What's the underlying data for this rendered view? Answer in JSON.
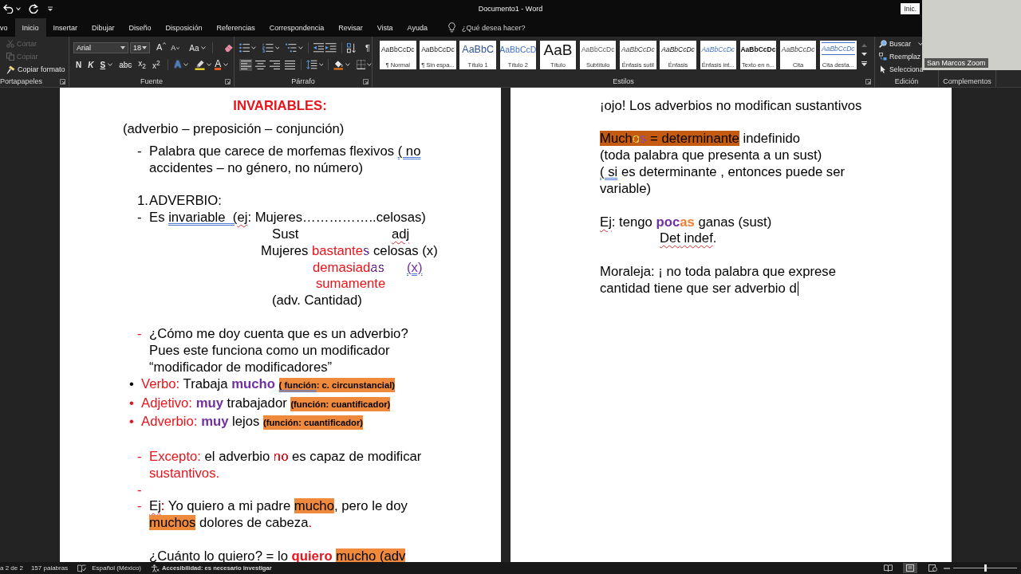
{
  "window": {
    "title": "Documento1 - Word",
    "account_button": "Inic."
  },
  "ribbon_tabs": [
    {
      "label": "vo",
      "selected": false
    },
    {
      "label": "Inicio",
      "selected": true
    },
    {
      "label": "Insertar",
      "selected": false
    },
    {
      "label": "Dibujar",
      "selected": false
    },
    {
      "label": "Diseño",
      "selected": false
    },
    {
      "label": "Disposición",
      "selected": false
    },
    {
      "label": "Referencias",
      "selected": false
    },
    {
      "label": "Correspondencia",
      "selected": false
    },
    {
      "label": "Revisar",
      "selected": false
    },
    {
      "label": "Vista",
      "selected": false
    },
    {
      "label": "Ayuda",
      "selected": false
    }
  ],
  "tell_me": {
    "placeholder": "¿Qué desea hacer?"
  },
  "ribbon": {
    "clipboard": {
      "label": "Portapapeles",
      "commands": [
        {
          "label": "Cortar",
          "kind": "cut",
          "disabled": true
        },
        {
          "label": "Copiar",
          "kind": "copy",
          "disabled": true
        },
        {
          "label": "Copiar formato",
          "kind": "format-painter",
          "disabled": false
        }
      ]
    },
    "font": {
      "label": "Fuente",
      "font_name": "Arial",
      "font_size": "18",
      "size_buttons": [
        {
          "label": "A",
          "kind": "grow"
        },
        {
          "label": "A",
          "kind": "shrink"
        },
        {
          "label": "Aa",
          "kind": "case"
        }
      ],
      "format_buttons": [
        {
          "label": "N",
          "kind": "bold"
        },
        {
          "label": "K",
          "kind": "italic"
        },
        {
          "label": "S",
          "kind": "underline"
        },
        {
          "label": "abc",
          "kind": "strike"
        },
        {
          "label": "x$_{2}$",
          "kind": "subscript"
        },
        {
          "label": "x$^{2}$",
          "kind": "superscript"
        }
      ],
      "color_buttons": [
        {
          "label": "A",
          "kind": "effects"
        },
        {
          "label": "A",
          "kind": "font-color"
        }
      ]
    },
    "paragraph": {
      "label": "Párrafo",
      "marks_button": "¶",
      "alignment": [
        {
          "kind": "left",
          "selected": true
        },
        {
          "kind": "center",
          "selected": false
        },
        {
          "kind": "right",
          "selected": false
        },
        {
          "kind": "justify",
          "selected": false
        }
      ]
    },
    "styles": {
      "label": "Estilos",
      "items": [
        {
          "preview": "AaBbCcDc",
          "name": "¶ Normal",
          "kind": "normal"
        },
        {
          "preview": "AaBbCcDc",
          "name": "¶ Sin espa...",
          "kind": "no-spacing"
        },
        {
          "preview": "AaBbC",
          "name": "Título 1",
          "kind": "heading-1"
        },
        {
          "preview": "AaBbCcD",
          "name": "Título 2",
          "kind": "heading-2"
        },
        {
          "preview": "AaB",
          "name": "Título",
          "kind": "title"
        },
        {
          "preview": "AaBbCcDc",
          "name": "Subtítulo",
          "kind": "subtitle"
        },
        {
          "preview": "AaBbCcDc",
          "name": "Énfasis sutil",
          "kind": "subtle-emphasis"
        },
        {
          "preview": "AaBbCcDc",
          "name": "Énfasis",
          "kind": "emphasis"
        },
        {
          "preview": "AaBbCcDc",
          "name": "Énfasis int...",
          "kind": "intense-emphasis"
        },
        {
          "preview": "AaBbCcDc",
          "name": "Texto en n...",
          "kind": "strong"
        },
        {
          "preview": "AaBbCcDc",
          "name": "Cita",
          "kind": "quote"
        },
        {
          "preview": "AaBbCcDc",
          "name": "Cita desta...",
          "kind": "intense-quote"
        }
      ]
    },
    "editing": {
      "label": "Edición",
      "commands": [
        {
          "label": "Buscar",
          "kind": "find"
        },
        {
          "label": "Reemplaz",
          "kind": "replace"
        },
        {
          "label": "Selecciona",
          "kind": "select"
        }
      ]
    },
    "addins": {
      "label": "Complementos"
    }
  },
  "video_overlay": {
    "participant": "San Marcos Zoom"
  },
  "document": {
    "pages": [
      {
        "sections": [
          {
            "paragraphs": [
              {
                "kind": "title",
                "runs": [
                  {
                    "text": "INVARIABLES:",
                    "color": "#e8141b"
                  }
                ]
              },
              {
                "kind": "lead",
                "runs": [
                  {
                    "text": "(adverbio – preposición – conjunción)"
                  }
                ]
              },
              {
                "kind": "dash",
                "marker": {
                  "symbol": "-",
                  "color": "#000000"
                },
                "runs": [
                  {
                    "text": "Palabra que carece de morfemas flexivos "
                  },
                  {
                    "text": "( no",
                    "grammar_error": true
                  },
                  {
                    "text": " accidentes – no género, no número)"
                  }
                ]
              }
            ]
          },
          {
            "paragraphs": [
              {
                "kind": "numbered",
                "marker": {
                  "symbol": "1.",
                  "color": "#000000"
                },
                "runs": [
                  {
                    "text": "ADVERBIO:"
                  }
                ]
              },
              {
                "kind": "dash",
                "marker": {
                  "symbol": "-",
                  "color": "#000000"
                },
                "runs": [
                  {
                    "text": "Es "
                  },
                  {
                    "text": "invariable  (",
                    "grammar_error": true
                  },
                  {
                    "text": "ej",
                    "spelling_error": true
                  },
                  {
                    "text": ": Mujeres……………..celosas)"
                  }
                ]
              },
              {
                "kind": "aligned",
                "segments": [
                  {
                    "runs": [
                      {
                        "text": "Sust"
                      }
                    ]
                  },
                  {
                    "runs": [
                      {
                        "text": "adj",
                        "spelling_error": true
                      }
                    ]
                  }
                ]
              },
              {
                "kind": "aligned",
                "segments": [
                  {
                    "runs": [
                      {
                        "text": "Mujeres "
                      },
                      {
                        "text": "bastante",
                        "color": "#e8141b"
                      },
                      {
                        "text": "s",
                        "color": "#7030a0"
                      },
                      {
                        "text": " celosas (x)"
                      }
                    ]
                  }
                ]
              },
              {
                "kind": "aligned",
                "segments": [
                  {
                    "runs": [
                      {
                        "text": "demasiad",
                        "color": "#e8141b"
                      },
                      {
                        "text": "as",
                        "color": "#7030a0"
                      }
                    ]
                  },
                  {
                    "runs": [
                      {
                        "text": "(x)",
                        "color": "#7030a0",
                        "grammar_error": true
                      }
                    ]
                  }
                ]
              },
              {
                "kind": "aligned",
                "segments": [
                  {
                    "runs": [
                      {
                        "text": "sumamente",
                        "color": "#e8141b"
                      }
                    ]
                  }
                ]
              },
              {
                "kind": "aligned",
                "segments": [
                  {
                    "runs": [
                      {
                        "text": "(adv. Cantidad)"
                      }
                    ]
                  }
                ]
              }
            ]
          },
          {
            "paragraphs": [
              {
                "kind": "dash",
                "marker": {
                  "symbol": "-",
                  "color": "#e8141b"
                },
                "runs": [
                  {
                    "text": "¿Cómo me doy cuenta que es un adverbio? Pues este funciona como un modificador “modificador de modificadores”"
                  }
                ]
              },
              {
                "kind": "bullet",
                "marker": {
                  "symbol": "•",
                  "color": "#000000"
                },
                "runs": [
                  {
                    "text": "Verbo: ",
                    "color": "#e8141b"
                  },
                  {
                    "text": "Trabaja "
                  },
                  {
                    "text": "**mucho** ",
                    "color": "#7030a0"
                  },
                  {
                    "text": "( función",
                    "kind": "note",
                    "highlight": {
                      "color": "#ef8a3c"
                    },
                    "grammar_error": true
                  },
                  {
                    "text": ": c. circunstancial)",
                    "kind": "note",
                    "highlight": {
                      "color": "#ef8a3c"
                    }
                  }
                ]
              },
              {
                "kind": "bullet",
                "marker": {
                  "symbol": "•",
                  "color": "#e8141b"
                },
                "runs": [
                  {
                    "text": "Adjetivo: ",
                    "color": "#e8141b"
                  },
                  {
                    "text": "**muy**",
                    "color": "#7030a0"
                  },
                  {
                    "text": " trabajador "
                  },
                  {
                    "text": "(función: cuantificador)",
                    "kind": "note",
                    "highlight": {
                      "color": "#ef8a3c"
                    }
                  }
                ]
              },
              {
                "kind": "bullet",
                "marker": {
                  "symbol": "•",
                  "color": "#e8141b"
                },
                "runs": [
                  {
                    "text": "Adverbio: ",
                    "color": "#e8141b"
                  },
                  {
                    "text": "**muy**",
                    "color": "#7030a0"
                  },
                  {
                    "text": " lejos "
                  },
                  {
                    "text": "(función: cuantificador)",
                    "kind": "note",
                    "highlight": {
                      "color": "#ef8a3c"
                    }
                  }
                ]
              }
            ]
          },
          {
            "paragraphs": [
              {
                "kind": "dash",
                "marker": {
                  "symbol": "-",
                  "color": "#e8141b"
                },
                "runs": [
                  {
                    "text": "Excepto: ",
                    "color": "#e8141b"
                  },
                  {
                    "text": "el adverbio "
                  },
                  {
                    "text": "no",
                    "color": "#e8141b"
                  },
                  {
                    "text": " es capaz de modificar "
                  },
                  {
                    "text": "sustantivos.",
                    "color": "#e8141b"
                  }
                ]
              },
              {
                "kind": "dash",
                "marker": {
                  "symbol": "-",
                  "color": "#e8141b"
                }
              },
              {
                "kind": "dash",
                "marker": {
                  "symbol": "-",
                  "color": "#e8141b"
                },
                "runs": [
                  {
                    "text": "Ej",
                    "spelling_error": true
                  },
                  {
                    "text": ":",
                    "color": "#e8141b"
                  },
                  {
                    "text": " Yo quiero a mi padre "
                  },
                  {
                    "text": "mucho",
                    "highlight": {
                      "color": "#ef8a3c"
                    }
                  },
                  {
                    "text": ", pero le doy "
                  },
                  {
                    "text": "muchos",
                    "highlight": {
                      "color": "#ef8a3c"
                    }
                  },
                  {
                    "text": " dolores de cabeza"
                  },
                  {
                    "text": ".",
                    "color": "#e8141b"
                  }
                ]
              }
            ]
          },
          {
            "paragraphs": [
              {
                "kind": "list-text",
                "runs": [
                  {
                    "text": "¿Cuánto lo quiero? = lo "
                  },
                  {
                    "text": "**quiero** ",
                    "color": "#e8141b"
                  },
                  {
                    "text": "mucho (",
                    "highlight": {
                      "color": "#ef8a3c"
                    }
                  },
                  {
                    "text": "adv",
                    "highlight": {
                      "color": "#ef8a3c"
                    },
                    "spelling_error": true
                  }
                ]
              }
            ]
          }
        ]
      },
      {
        "sections": [
          {
            "paragraphs": [
              {
                "kind": "plain",
                "runs": [
                  {
                    "text": "¡ojo! Los adverbios no modifican sustantivos"
                  }
                ]
              }
            ]
          },
          {
            "paragraphs": [
              {
                "kind": "plain",
                "runs": [
                  {
                    "text": "Much",
                    "highlight": {
                      "color": "#c55a11"
                    }
                  },
                  {
                    "text": "o",
                    "color": "#d6c24a",
                    "highlight": {
                      "color": "#c55a11"
                    }
                  },
                  {
                    "text": "s",
                    "color": "#8e4aa8",
                    "highlight": {
                      "color": "#c55a11"
                    }
                  },
                  {
                    "text": " = determinante",
                    "highlight": {
                      "color": "#c55a11"
                    }
                  },
                  {
                    "text": " indefinido"
                  }
                ]
              },
              {
                "kind": "plain",
                "runs": [
                  {
                    "text": "(toda palabra que presenta a un sust)"
                  }
                ]
              },
              {
                "kind": "plain",
                "runs": [
                  {
                    "text": "( si",
                    "grammar_error": true
                  },
                  {
                    "text": " es determinante , entonces puede ser variable)"
                  }
                ]
              }
            ]
          },
          {
            "paragraphs": [
              {
                "kind": "plain",
                "runs": [
                  {
                    "text": "Ej",
                    "spelling_error": true
                  },
                  {
                    "text": ": tengo "
                  },
                  {
                    "text": "**poc**",
                    "color": "#7030a0"
                  },
                  {
                    "text": "**as**",
                    "color": "#ed7d31"
                  },
                  {
                    "text": " ganas (sust)"
                  }
                ]
              },
              {
                "kind": "tabbed",
                "runs": [
                  {
                    "text": "Det",
                    "spelling_error": true
                  },
                  {
                    "text": " indef",
                    "spelling_error": true
                  },
                  {
                    "text": "."
                  }
                ]
              }
            ]
          },
          {
            "paragraphs": [
              {
                "kind": "plain",
                "caret": true,
                "runs": [
                  {
                    "text": "Moraleja: ¡ no toda palabra que exprese cantidad tiene que ser adverbio d"
                  }
                ]
              }
            ]
          }
        ]
      }
    ]
  },
  "status_bar": {
    "page": "a 2 de 2",
    "words": "157 palabras",
    "language": "Español (México)",
    "accessibility": "Accesibilidad: es necesario investigar",
    "views": [
      {
        "kind": "read",
        "selected": false
      },
      {
        "kind": "print",
        "selected": true
      },
      {
        "kind": "web",
        "selected": false
      }
    ],
    "zoom": {
      "level": 0.5
    }
  }
}
